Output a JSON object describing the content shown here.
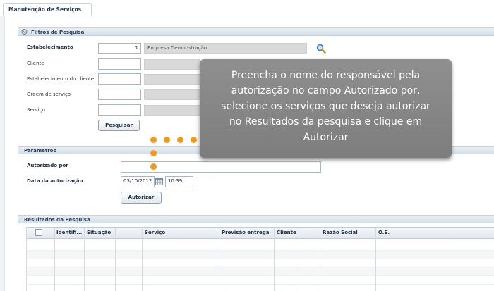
{
  "tab": {
    "label": "Manutenção de Serviços"
  },
  "filters": {
    "header": "Filtros de Pesquisa",
    "estabelecimento": {
      "label": "Estabelecimento",
      "code": "1",
      "name": "Empresa Demonstração"
    },
    "cliente": {
      "label": "Cliente"
    },
    "estab_cliente": {
      "label": "Estabelecimento do cliente"
    },
    "ordem_servico": {
      "label": "Ordem de serviço"
    },
    "servico": {
      "label": "Serviço"
    },
    "search_button": "Pesquisar"
  },
  "params": {
    "header": "Parâmetros",
    "autorizado_por": {
      "label": "Autorizado por",
      "value": ""
    },
    "data_autorizacao": {
      "label": "Data da autorização",
      "date": "03/10/2012",
      "time": "10:39"
    },
    "authorize_button": "Autorizar"
  },
  "results": {
    "header": "Resultados da Pesquisa",
    "columns": [
      "Identifi...",
      "Situação",
      "",
      "Serviço",
      "Previsão entrega",
      "Cliente",
      "",
      "Razão Social",
      "O.S."
    ]
  },
  "tooltip": {
    "text": "Preencha o nome do responsável pela autorização no campo Autorizado por, selecione os serviços que deseja autorizar no Resultados da pesquisa e clique em Autorizar"
  },
  "colors": {
    "accent_dot": "#f39a1d",
    "tooltip_bg": "#888888",
    "header_bg": "#dfe7f0"
  }
}
